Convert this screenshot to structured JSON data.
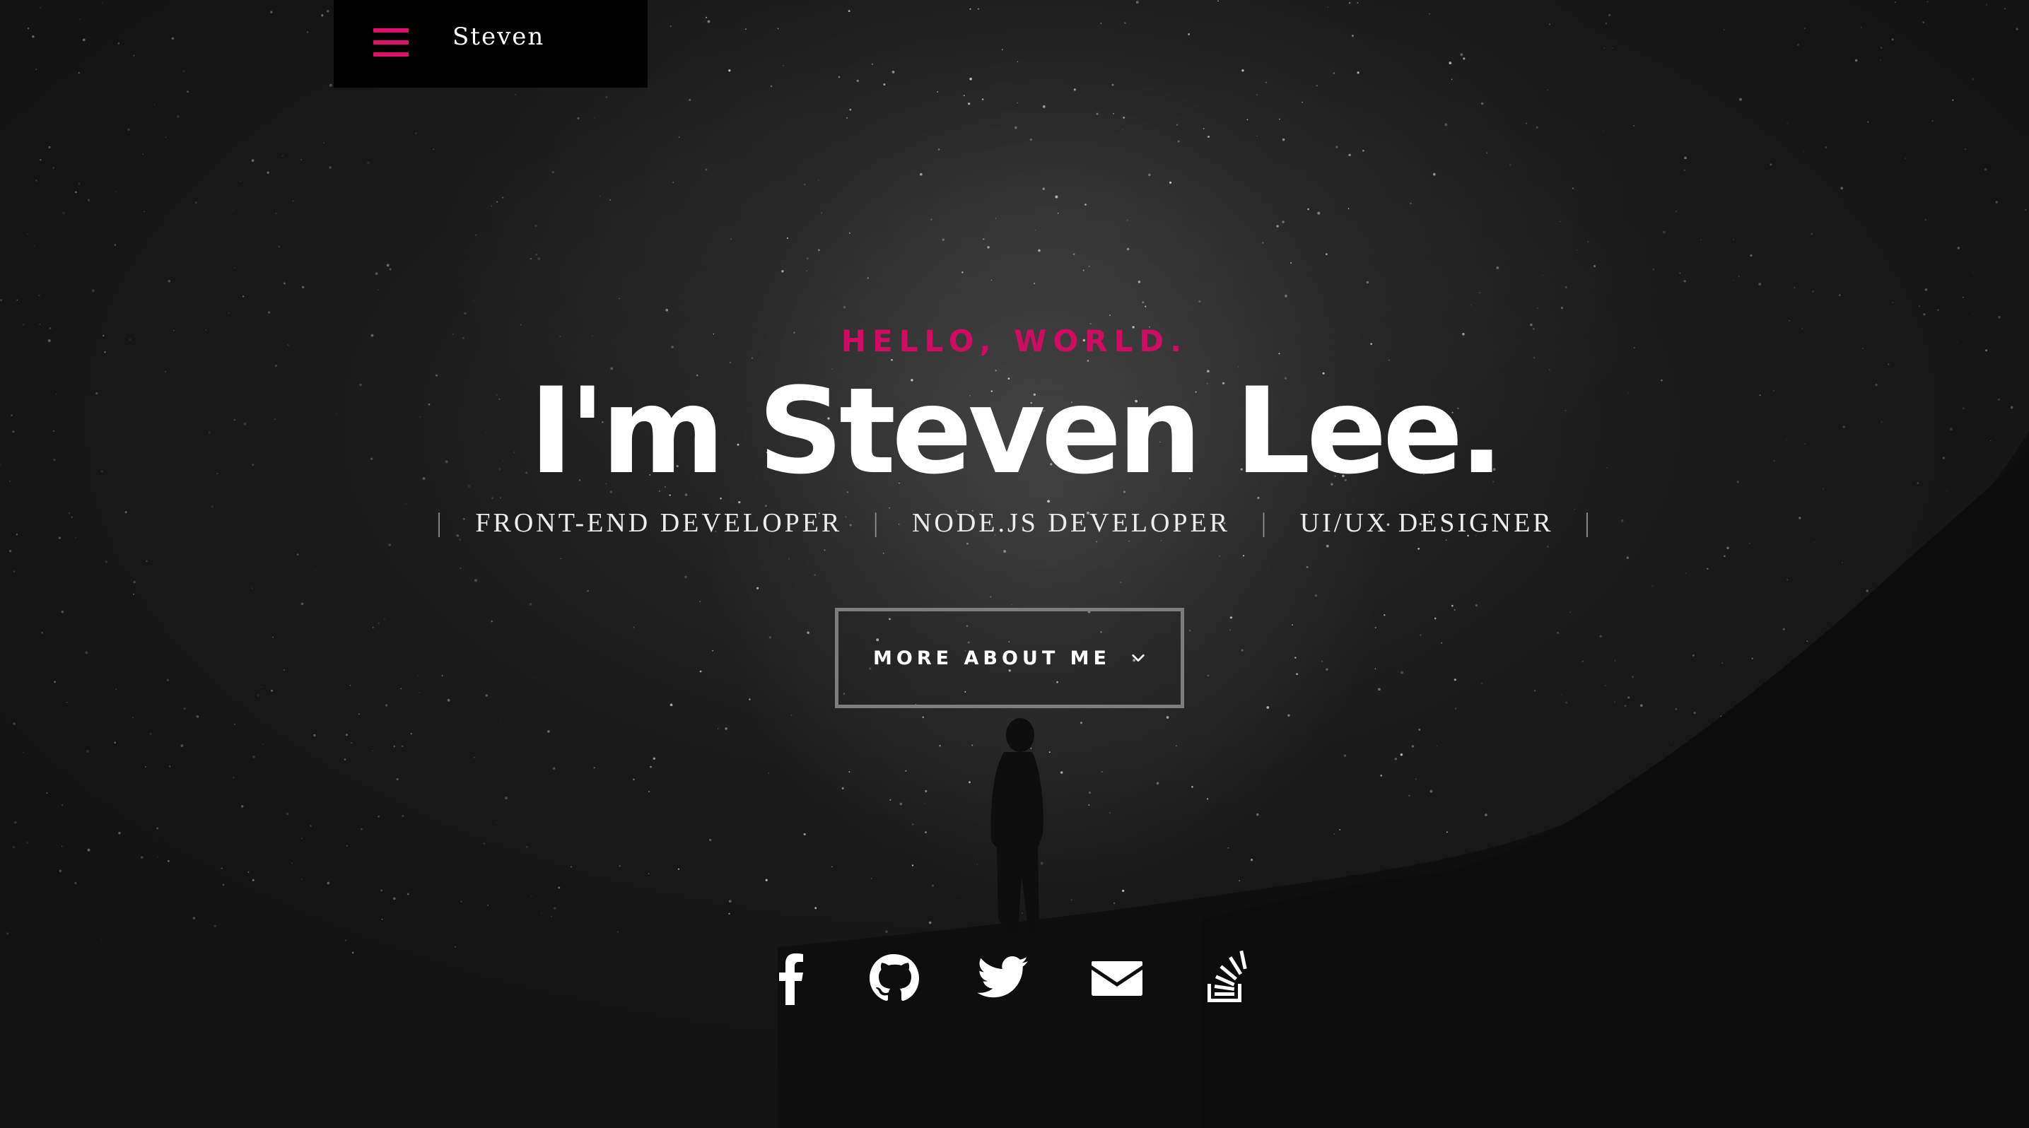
{
  "header": {
    "logo_text": "Steven",
    "menu_icon": "hamburger-menu-icon"
  },
  "hero": {
    "greeting": "HELLO, WORLD.",
    "title": "I'm Steven Lee.",
    "roles": [
      "FRONT-END DEVELOPER",
      "NODE.JS DEVELOPER",
      "UI/UX DESIGNER"
    ],
    "cta_label": "MORE ABOUT ME",
    "cta_icon": "chevron-down-icon"
  },
  "social": [
    {
      "name": "facebook-icon"
    },
    {
      "name": "github-icon"
    },
    {
      "name": "twitter-icon"
    },
    {
      "name": "email-icon"
    },
    {
      "name": "stackoverflow-icon"
    }
  ],
  "colors": {
    "accent": "#e0106c",
    "greeting": "#cf0c62",
    "background": "#111111",
    "text": "#ffffff"
  }
}
